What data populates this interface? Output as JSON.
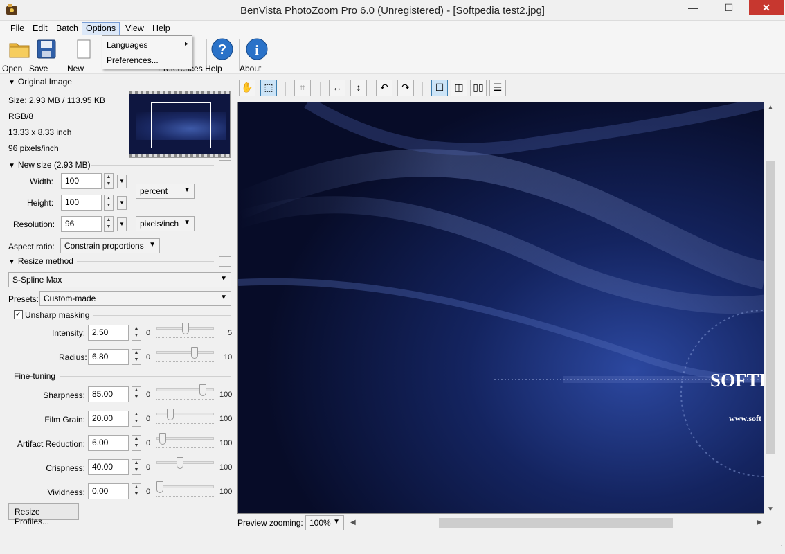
{
  "window": {
    "title": "BenVista PhotoZoom Pro 6.0 (Unregistered) - [Softpedia test2.jpg]",
    "minimize": "—",
    "maximize": "☐",
    "close": "✕"
  },
  "menu": [
    "File",
    "Edit",
    "Batch",
    "Options",
    "View",
    "Help"
  ],
  "options_menu": {
    "items": [
      {
        "label": "Languages",
        "submenu_arrow": "▸"
      },
      {
        "label": "Preferences..."
      }
    ]
  },
  "toolbar": {
    "open": "Open",
    "save": "Save",
    "new": "New",
    "preferences": "Preferences",
    "help": "Help",
    "about": "About"
  },
  "original_image": {
    "header": "Original Image",
    "size": "Size: 2.93 MB / 113.95 KB",
    "mode": "RGB/8",
    "dimensions": "13.33 x 8.33 inch",
    "resolution": "96 pixels/inch"
  },
  "new_size": {
    "header": "New size (2.93 MB)",
    "dots": "...",
    "width_label": "Width:",
    "width_value": "100",
    "height_label": "Height:",
    "height_value": "100",
    "resolution_label": "Resolution:",
    "resolution_value": "96",
    "unit_size": "percent",
    "unit_resolution": "pixels/inch",
    "aspect_label": "Aspect ratio:",
    "aspect_value": "Constrain proportions"
  },
  "resize_method": {
    "header": "Resize method",
    "dots": "...",
    "method": "S-Spline Max",
    "presets_label": "Presets:",
    "presets_value": "Custom-made"
  },
  "unsharp": {
    "label": "Unsharp masking",
    "checked": true,
    "intensity": {
      "label": "Intensity:",
      "value": "2.50",
      "min": "0",
      "max": "5",
      "level": 0.5
    },
    "radius": {
      "label": "Radius:",
      "value": "6.80",
      "min": "0",
      "max": "10",
      "level": 0.68
    }
  },
  "fine_tuning": {
    "header": "Fine-tuning",
    "params": [
      {
        "label": "Sharpness:",
        "value": "85.00",
        "min": "0",
        "max": "100",
        "level": 0.85
      },
      {
        "label": "Film Grain:",
        "value": "20.00",
        "min": "0",
        "max": "100",
        "level": 0.2
      },
      {
        "label": "Artifact Reduction:",
        "value": "6.00",
        "min": "0",
        "max": "100",
        "level": 0.06
      },
      {
        "label": "Crispness:",
        "value": "40.00",
        "min": "0",
        "max": "100",
        "level": 0.4
      },
      {
        "label": "Vividness:",
        "value": "0.00",
        "min": "0",
        "max": "100",
        "level": 0.0
      }
    ]
  },
  "resize_profiles": "Resize Profiles...",
  "preview": {
    "zoom_label": "Preview zooming:",
    "zoom_value": "100%",
    "image_text_logo": "SOFTI",
    "image_text_url": "www.soft"
  },
  "colors": {
    "accent": "#3c7fb1",
    "close_button": "#c7372f",
    "preview_bg": "#0a0f2a"
  }
}
